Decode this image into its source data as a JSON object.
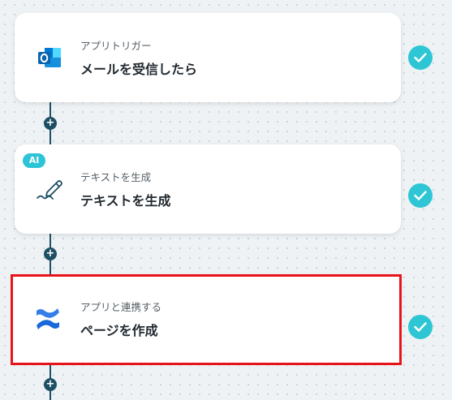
{
  "colors": {
    "accent": "#2ec6d4",
    "connector": "#1d4f63",
    "selection": "#e8141b"
  },
  "steps": [
    {
      "subtitle": "アプリトリガー",
      "title": "メールを受信したら",
      "icon": "outlook-icon",
      "completed": true
    },
    {
      "badge": "AI",
      "subtitle": "テキストを生成",
      "title": "テキストを生成",
      "icon": "pen-icon",
      "completed": true
    },
    {
      "subtitle": "アプリと連携する",
      "title": "ページを作成",
      "icon": "confluence-icon",
      "completed": true,
      "selected": true
    }
  ],
  "add_button_label": "+"
}
